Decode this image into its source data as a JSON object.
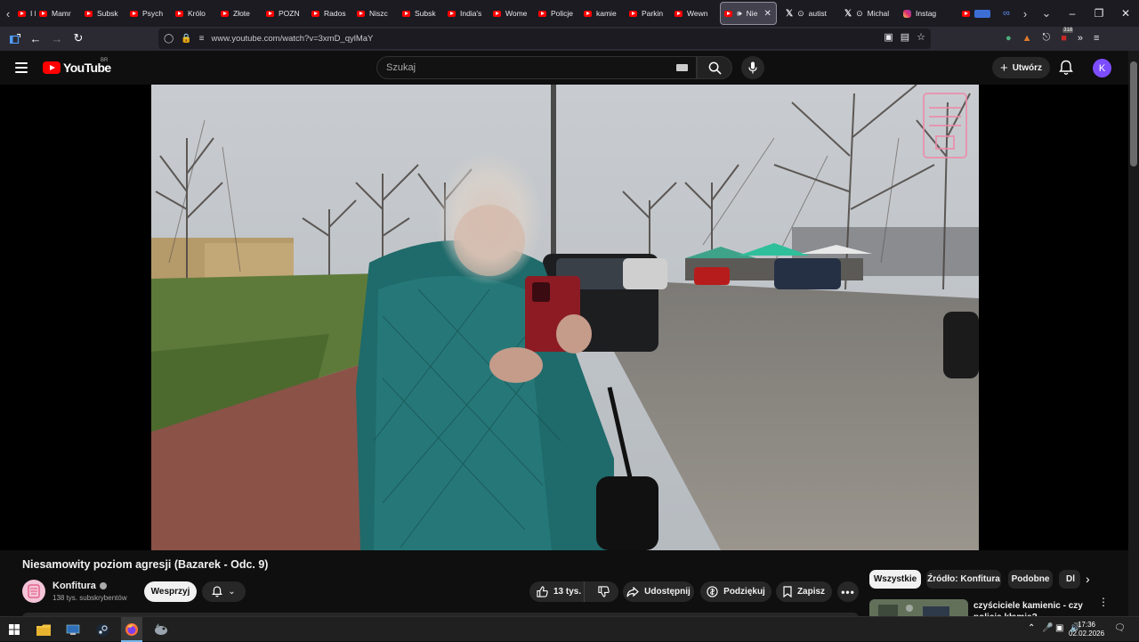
{
  "browser": {
    "tabs": [
      {
        "label": "I b",
        "icon": "youtube-icon"
      },
      {
        "label": "Mamr",
        "icon": "youtube-icon"
      },
      {
        "label": "Subsk",
        "icon": "youtube-icon"
      },
      {
        "label": "Psych",
        "icon": "youtube-icon"
      },
      {
        "label": "Królo",
        "icon": "youtube-icon"
      },
      {
        "label": "Złote",
        "icon": "youtube-icon"
      },
      {
        "label": "POZN",
        "icon": "youtube-icon"
      },
      {
        "label": "Rados",
        "icon": "youtube-icon"
      },
      {
        "label": "Niszc",
        "icon": "youtube-icon"
      },
      {
        "label": "Subsk",
        "icon": "youtube-icon"
      },
      {
        "label": "India's",
        "icon": "youtube-icon"
      },
      {
        "label": "Wome",
        "icon": "youtube-icon"
      },
      {
        "label": "Policje",
        "icon": "youtube-icon"
      },
      {
        "label": "kamie",
        "icon": "youtube-icon"
      },
      {
        "label": "Parkin",
        "icon": "youtube-icon"
      },
      {
        "label": "Wewn",
        "icon": "youtube-icon"
      }
    ],
    "active_tab": {
      "label": "Nie",
      "icon": "youtube-icon"
    },
    "tabs_right": [
      {
        "label": "autist",
        "icon": "x-icon"
      },
      {
        "label": "Michal",
        "icon": "x-icon"
      },
      {
        "label": "Instag",
        "icon": "instagram-icon"
      }
    ],
    "badge_count": "318",
    "url": "www.youtube.com/watch?v=3xmD_qylMaY"
  },
  "youtube": {
    "logo_text": "YouTube",
    "country_code": "BR",
    "search_placeholder": "Szukaj",
    "create_label": "Utwórz",
    "avatar_letter": "K"
  },
  "video": {
    "title": "Niesamowity poziom agresji (Bazarek - Odc. 9)",
    "channel": "Konfitura",
    "subscribers": "138 tys. subskrybentów",
    "support_label": "Wesprzyj",
    "likes": "13 tys.",
    "share_label": "Udostępnij",
    "thanks_label": "Podziękuj",
    "save_label": "Zapisz"
  },
  "chips": {
    "all": "Wszystkie",
    "source": "Źródło: Konfitura",
    "similar": "Podobne",
    "more": "Dl"
  },
  "recommendation": {
    "title": "czyściciele kamienic - czy policja kłamie?"
  },
  "taskbar": {
    "time": "17:36",
    "date": "02.02.2026"
  }
}
